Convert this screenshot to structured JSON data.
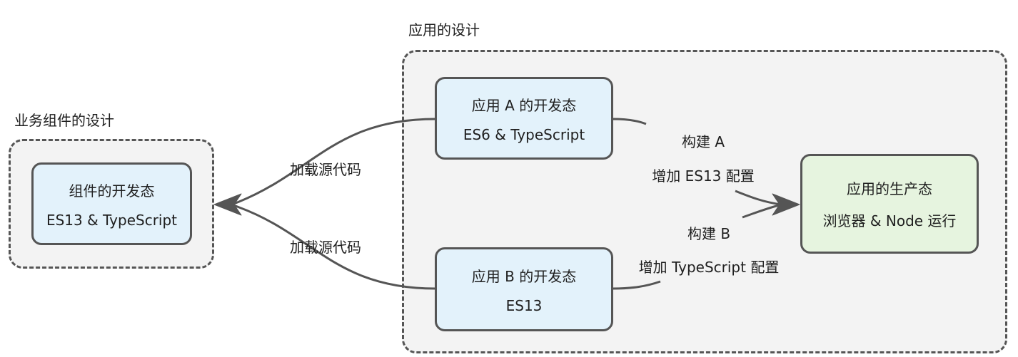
{
  "groups": {
    "business": {
      "label": "业务组件的设计"
    },
    "app": {
      "label": "应用的设计"
    }
  },
  "nodes": {
    "component": {
      "title": "组件的开发态",
      "subtitle": "ES13 & TypeScript"
    },
    "app_a": {
      "title": "应用 A 的开发态",
      "subtitle": "ES6 & TypeScript"
    },
    "app_b": {
      "title": "应用 B 的开发态",
      "subtitle": "ES13"
    },
    "production": {
      "title": "应用的生产态",
      "subtitle": "浏览器 & Node 运行"
    }
  },
  "edges": {
    "load_a": {
      "label": "加载源代码"
    },
    "load_b": {
      "label": "加载源代码"
    },
    "build_a": {
      "label": "构建 A",
      "note": "增加 ES13 配置"
    },
    "build_b": {
      "label": "构建 B",
      "note": "增加 TypeScript 配置"
    }
  },
  "colors": {
    "node_dev": "#e3f2fb",
    "node_prod": "#e6f4df",
    "group_bg": "#f3f3f3",
    "stroke": "#555555"
  }
}
